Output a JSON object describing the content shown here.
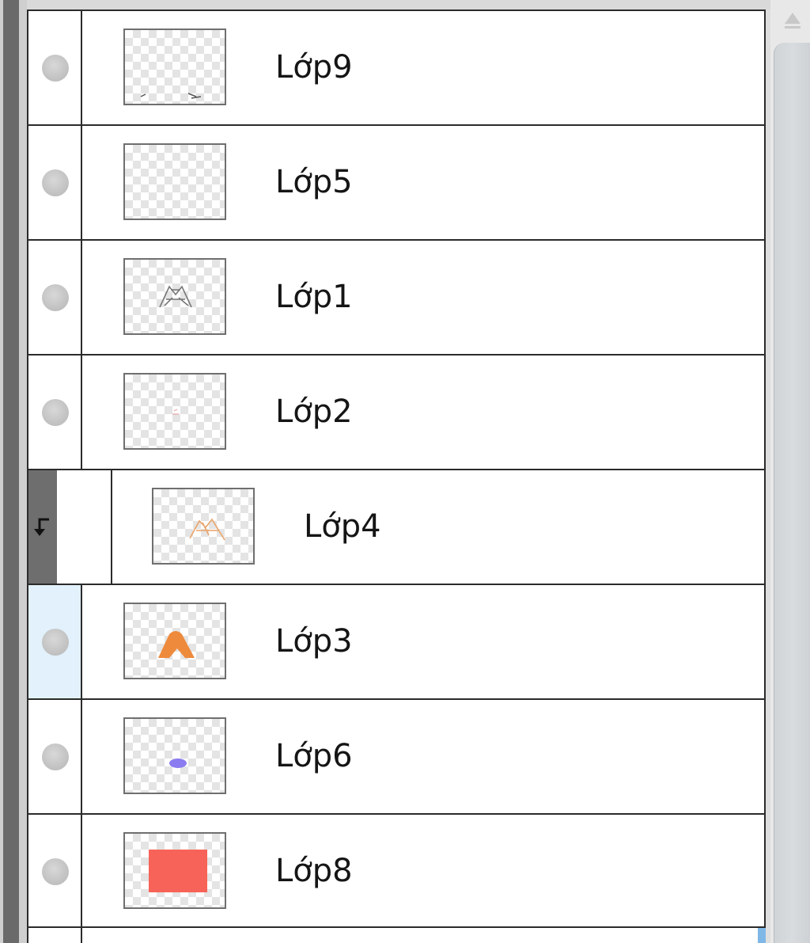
{
  "layers_panel": {
    "rows": [
      {
        "name": "Lớp9",
        "visible_toggle": "visibility-dot",
        "thumbnail": "small-marks",
        "selected": false,
        "clipped": false
      },
      {
        "name": "Lớp5",
        "visible_toggle": "visibility-dot",
        "thumbnail": "empty",
        "selected": false,
        "clipped": false
      },
      {
        "name": "Lớp1",
        "visible_toggle": "visibility-dot",
        "thumbnail": "sketch-lines",
        "selected": false,
        "clipped": false
      },
      {
        "name": "Lớp2",
        "visible_toggle": "visibility-dot",
        "thumbnail": "faint-mark",
        "selected": false,
        "clipped": false
      },
      {
        "name": "Lớp4",
        "visible_toggle": "clipping-arrow-icon",
        "thumbnail": "orange-sketch",
        "selected": false,
        "clipped": true
      },
      {
        "name": "Lớp3",
        "visible_toggle": "visibility-dot",
        "thumbnail": "orange-shape",
        "selected": true,
        "clipped": false
      },
      {
        "name": "Lớp6",
        "visible_toggle": "visibility-dot",
        "thumbnail": "purple-blob",
        "selected": false,
        "clipped": false
      },
      {
        "name": "Lớp8",
        "visible_toggle": "visibility-dot",
        "thumbnail": "red-rectangle",
        "selected": false,
        "clipped": false
      }
    ]
  },
  "colors": {
    "selected_row_bg": "#e2f1fb",
    "orange": "#ee8a3c",
    "purple": "#8a7cf0",
    "red": "#f76358",
    "clip_bar": "#6e6e6e"
  },
  "icons": {
    "visibility": "visibility-dot",
    "clipping": "clipping-arrow-icon",
    "scroll_up": "scroll-up-arrow-icon"
  }
}
